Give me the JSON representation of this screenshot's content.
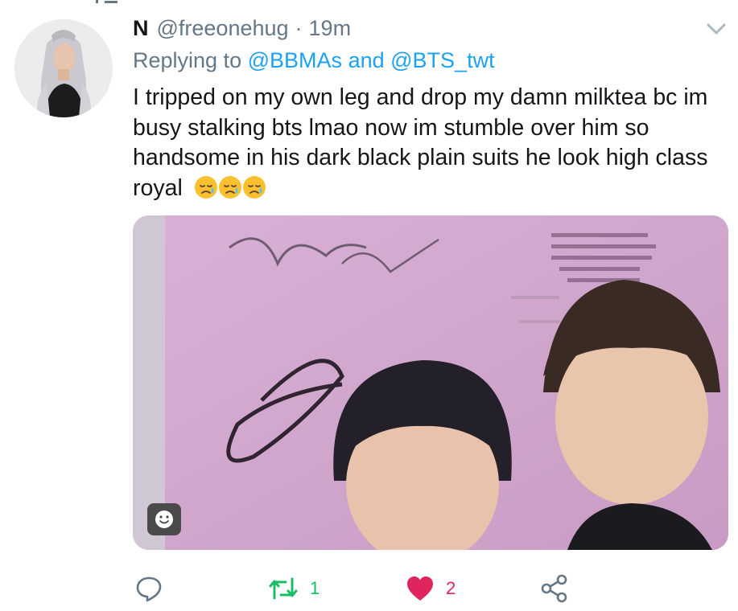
{
  "tweet": {
    "display_name": "N",
    "handle": "@freeonehug",
    "separator": "·",
    "time": "19m",
    "replying_prefix": "Replying to",
    "replying_to": [
      "@BBMAs",
      "@BTS_twt"
    ],
    "replying_joiner": "and",
    "text": "I tripped on my own leg and drop my damn milktea bc im busy stalking bts lmao now im stumble over him so handsome in his dark black plain suits he look high class royal",
    "emojis": [
      "disappointed-relieved-face",
      "disappointed-relieved-face",
      "disappointed-relieved-face"
    ]
  },
  "media": {
    "content": "photo"
  },
  "actions": {
    "reply_icon": "comment-bubble-icon",
    "retweets": "1",
    "likes": "2",
    "share_icon": "share-icon"
  },
  "colors": {
    "link": "#1da1f2",
    "secondary": "#657786",
    "retweet": "#17bf63",
    "like": "#e0245e",
    "text": "#14171a"
  }
}
